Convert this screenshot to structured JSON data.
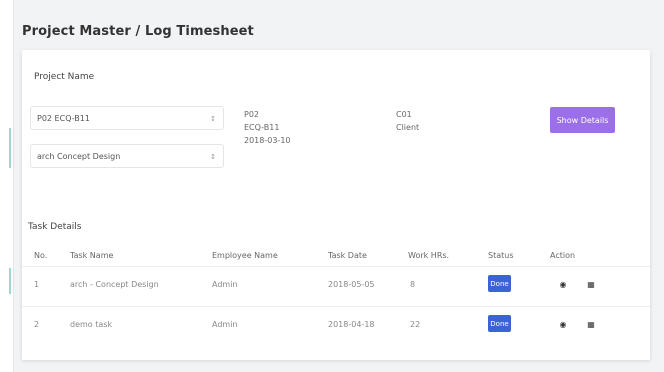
{
  "page": {
    "title": "Project Master / Log Timesheet"
  },
  "project": {
    "heading": "Project Name",
    "project_select": "P02 ECQ-B11",
    "phase_select": "arch Concept Design",
    "info_left": [
      "P02",
      "ECQ-B11",
      "2018-03-10"
    ],
    "info_right": [
      "C01",
      "Client"
    ],
    "show_details_label": "Show Details"
  },
  "tasks": {
    "heading": "Task Details",
    "columns": [
      "No.",
      "Task Name",
      "Employee Name",
      "Task Date",
      "Work HRs.",
      "Status",
      "Action"
    ],
    "rows": [
      {
        "no": "1",
        "task": "arch - Concept Design",
        "employee": "Admin",
        "date": "2018-05-05",
        "hours": "8",
        "status": "Done"
      },
      {
        "no": "2",
        "task": "demo task",
        "employee": "Admin",
        "date": "2018-04-18",
        "hours": "22",
        "status": "Done"
      }
    ]
  },
  "colors": {
    "accent": "#9b6fe8",
    "status_done": "#3b63d6"
  }
}
